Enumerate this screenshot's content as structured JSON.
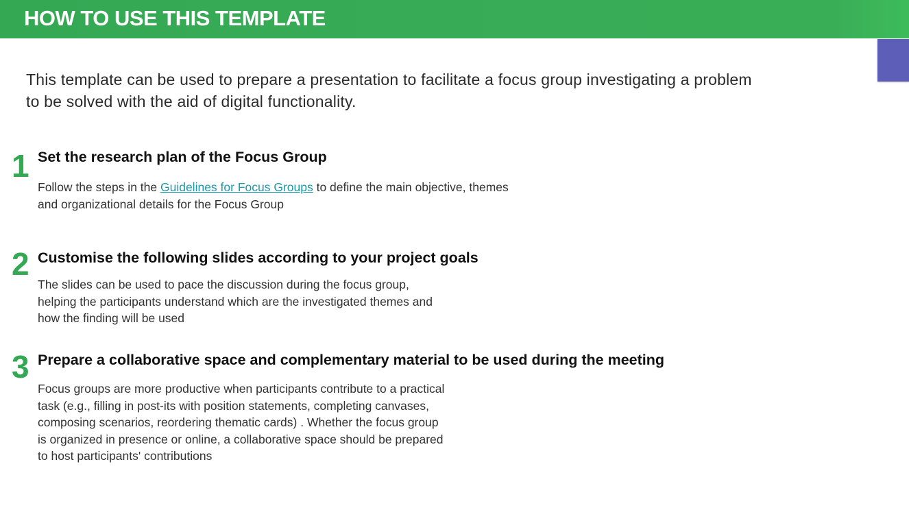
{
  "header": {
    "title": "HOW TO USE THIS TEMPLATE"
  },
  "intro": {
    "text": "This template can be used to prepare a presentation to facilitate a focus group investigating a problem to be solved with the aid of digital functionality."
  },
  "steps": [
    {
      "number": "1",
      "title": "Set the research plan of the Focus Group",
      "body_before_link": "Follow the steps in the ",
      "link_text": "Guidelines for Focus Groups",
      "body_after_link": " to define the main objective, themes and organizational details for the Focus Group"
    },
    {
      "number": "2",
      "title": "Customise the following slides according to your project goals",
      "body": "The slides can be used to pace the discussion during the focus group, helping the participants understand which are the investigated themes and how the finding will be used"
    },
    {
      "number": "3",
      "title": "Prepare a collaborative space and complementary material  to be used during the meeting",
      "body": "Focus groups are more productive when participants contribute to a practical task (e.g., filling in post-its with position statements, completing canvases, composing scenarios, reordering thematic cards) . Whether the focus group is organized in presence or online, a collaborative space should be prepared to host participants' contributions"
    }
  ],
  "colors": {
    "header_green": "#34a853",
    "step_number_green": "#34a853",
    "link_teal": "#1b9aaa",
    "side_tab_purple": "#5c5eb8"
  }
}
